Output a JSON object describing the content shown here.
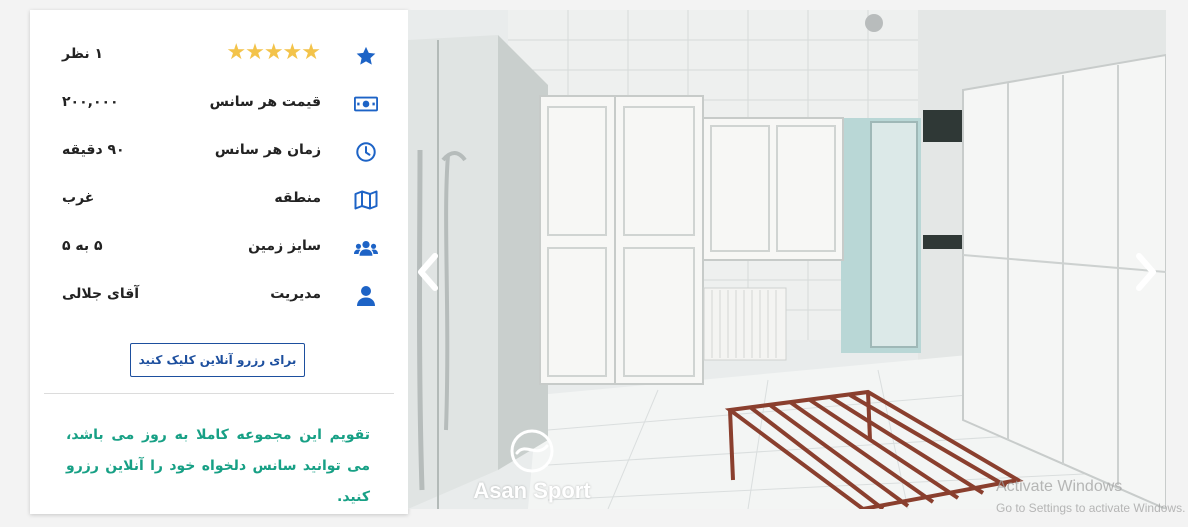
{
  "info_card": {
    "rows": [
      {
        "icon": "star-icon",
        "label": "",
        "value": "۱ نظر",
        "rating": 5,
        "stars_text": "★★★★★"
      },
      {
        "icon": "money-bill-icon",
        "label": "قیمت هر سانس",
        "value": "۲۰۰,۰۰۰"
      },
      {
        "icon": "clock-icon",
        "label": "زمان هر سانس",
        "value": "۹۰ دقیقه"
      },
      {
        "icon": "map-icon",
        "label": "منطقه",
        "value": "غرب"
      },
      {
        "icon": "users-icon",
        "label": "سایز زمین",
        "value": "۵ به ۵"
      },
      {
        "icon": "user-icon",
        "label": "مدیریت",
        "value": "آقای جلالی"
      }
    ],
    "reserve_button_label": "برای رزرو آنلاین کلیک کنید",
    "note": "تقویم این مجموعه کاملا به روز می باشد، می توانید سانس دلخواه خود را آنلاین رزرو کنید."
  },
  "gallery": {
    "prev_icon": "chevron-left-icon",
    "next_icon": "chevron-right-icon",
    "logo_text": "Asan Sport"
  },
  "os_watermark": {
    "line1": "Activate Windows",
    "line2": "Go to Settings to activate Windows."
  },
  "colors": {
    "accent_blue": "#1d63c6",
    "button_border": "#1d4f9e",
    "note_green": "#17a085",
    "star_gold": "#f3c34a"
  }
}
